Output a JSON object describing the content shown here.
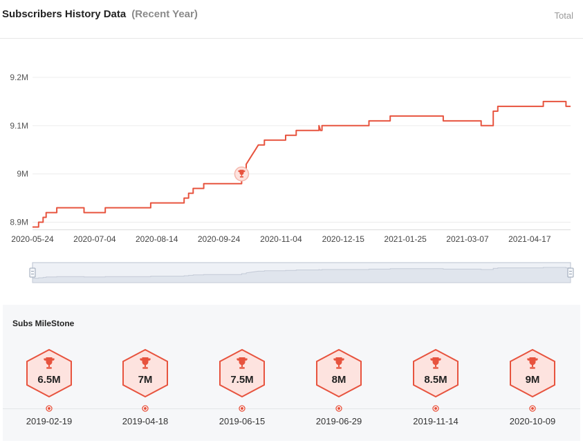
{
  "header": {
    "title": "Subscribers History Data",
    "subtitle": "(Recent Year)",
    "total_label": "Total"
  },
  "colors": {
    "line": "#e7533e",
    "accent": "#e7533e",
    "hex_fill": "#fde3df",
    "grid": "#ececec",
    "navigator_fill": "#e0e5ed",
    "navigator_stroke": "#c3cad6"
  },
  "chart_data": {
    "type": "line",
    "title": "Subscribers History Data",
    "xlabel": "",
    "ylabel": "",
    "x_range": [
      "2020-05-24",
      "2021-05-14"
    ],
    "ylim": [
      8.885,
      9.2
    ],
    "y_ticks": [
      {
        "label": "8.9M",
        "value": 8.9
      },
      {
        "label": "9M",
        "value": 9.0
      },
      {
        "label": "9.1M",
        "value": 9.1
      },
      {
        "label": "9.2M",
        "value": 9.2
      }
    ],
    "x_ticks": [
      "2020-05-24",
      "2020-07-04",
      "2020-08-14",
      "2020-09-24",
      "2020-11-04",
      "2020-12-15",
      "2021-01-25",
      "2021-03-07",
      "2021-04-17"
    ],
    "grid": true,
    "milestone_marker": {
      "x": "2020-10-09",
      "y": 9.0,
      "icon": "trophy-icon"
    },
    "series": [
      {
        "points": [
          [
            "2020-05-24",
            8.89
          ],
          [
            "2020-05-28",
            8.89
          ],
          [
            "2020-05-28",
            8.9
          ],
          [
            "2020-05-31",
            8.9
          ],
          [
            "2020-05-31",
            8.91
          ],
          [
            "2020-06-02",
            8.91
          ],
          [
            "2020-06-02",
            8.92
          ],
          [
            "2020-06-09",
            8.92
          ],
          [
            "2020-06-09",
            8.93
          ],
          [
            "2020-06-27",
            8.93
          ],
          [
            "2020-06-27",
            8.92
          ],
          [
            "2020-07-11",
            8.92
          ],
          [
            "2020-07-11",
            8.93
          ],
          [
            "2020-08-10",
            8.93
          ],
          [
            "2020-08-10",
            8.94
          ],
          [
            "2020-09-01",
            8.94
          ],
          [
            "2020-09-01",
            8.95
          ],
          [
            "2020-09-04",
            8.95
          ],
          [
            "2020-09-04",
            8.96
          ],
          [
            "2020-09-07",
            8.96
          ],
          [
            "2020-09-07",
            8.97
          ],
          [
            "2020-09-14",
            8.97
          ],
          [
            "2020-09-14",
            8.98
          ],
          [
            "2020-10-09",
            8.98
          ],
          [
            "2020-10-09",
            9.0
          ],
          [
            "2020-10-12",
            9.0
          ],
          [
            "2020-10-12",
            9.02
          ],
          [
            "2020-10-14",
            9.03
          ],
          [
            "2020-10-16",
            9.04
          ],
          [
            "2020-10-18",
            9.05
          ],
          [
            "2020-10-20",
            9.06
          ],
          [
            "2020-10-24",
            9.06
          ],
          [
            "2020-10-24",
            9.07
          ],
          [
            "2020-11-07",
            9.07
          ],
          [
            "2020-11-07",
            9.08
          ],
          [
            "2020-11-14",
            9.08
          ],
          [
            "2020-11-14",
            9.09
          ],
          [
            "2020-11-29",
            9.09
          ],
          [
            "2020-11-29",
            9.1
          ],
          [
            "2020-11-30",
            9.09
          ],
          [
            "2020-12-01",
            9.09
          ],
          [
            "2020-12-01",
            9.1
          ],
          [
            "2021-01-01",
            9.1
          ],
          [
            "2021-01-01",
            9.11
          ],
          [
            "2021-01-15",
            9.11
          ],
          [
            "2021-01-15",
            9.12
          ],
          [
            "2021-02-19",
            9.12
          ],
          [
            "2021-02-19",
            9.11
          ],
          [
            "2021-03-16",
            9.11
          ],
          [
            "2021-03-16",
            9.1
          ],
          [
            "2021-03-24",
            9.1
          ],
          [
            "2021-03-24",
            9.13
          ],
          [
            "2021-03-27",
            9.13
          ],
          [
            "2021-03-27",
            9.14
          ],
          [
            "2021-04-26",
            9.14
          ],
          [
            "2021-04-26",
            9.15
          ],
          [
            "2021-05-11",
            9.15
          ],
          [
            "2021-05-11",
            9.14
          ],
          [
            "2021-05-14",
            9.14
          ]
        ]
      }
    ]
  },
  "milestones": {
    "title": "Subs MileStone",
    "items": [
      {
        "label": "6.5M",
        "date": "2019-02-19"
      },
      {
        "label": "7M",
        "date": "2019-04-18"
      },
      {
        "label": "7.5M",
        "date": "2019-06-15"
      },
      {
        "label": "8M",
        "date": "2019-06-29"
      },
      {
        "label": "8.5M",
        "date": "2019-11-14"
      },
      {
        "label": "9M",
        "date": "2020-10-09"
      }
    ]
  }
}
